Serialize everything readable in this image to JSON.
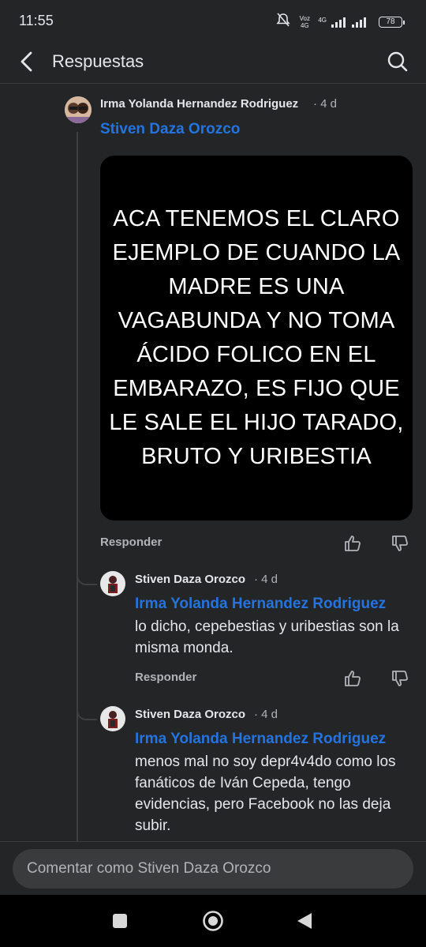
{
  "status_bar": {
    "time": "11:55",
    "volte": "Voz 4G",
    "network": "4G",
    "battery": "78",
    "icons": [
      "mute-icon",
      "signal-icon",
      "battery-icon"
    ]
  },
  "header": {
    "title": "Respuestas",
    "back_icon": "chevron-left-icon",
    "search_icon": "search-icon"
  },
  "comments": [
    {
      "author": "Irma Yolanda Hernandez Rodriguez",
      "time": "· 4 d",
      "mention": "Stiven Daza Orozco",
      "image_text": "ACA TENEMOS EL CLARO EJEMPLO DE CUANDO LA MADRE ES UNA VAGABUNDA Y NO TOMA ÁCIDO FOLICO EN EL EMBARAZO, ES FIJO QUE LE SALE EL HIJO TARADO, BRUTO Y URIBESTIA",
      "reply_label": "Responder"
    },
    {
      "author": "Stiven Daza Orozco",
      "time": "· 4 d",
      "mention": "Irma Yolanda Hernandez Rodriguez",
      "text": "lo dicho, cepebestias y uribestias son la misma monda.",
      "reply_label": "Responder"
    },
    {
      "author": "Stiven Daza Orozco",
      "time": "· 4 d",
      "mention": "Irma Yolanda Hernandez Rodriguez",
      "text": "menos mal no soy depr4v4do como los fanáticos de Iván Cepeda, tengo evidencias, pero Facebook no las deja subir."
    }
  ],
  "composer": {
    "placeholder": "Comentar como Stiven Daza Orozco"
  },
  "colors": {
    "background": "#242526",
    "mention": "#2374e1",
    "secondary_text": "#b0b3b8",
    "composer_bg": "#3a3b3c"
  },
  "nav": {
    "icons": [
      "recents-square-icon",
      "home-circle-icon",
      "back-triangle-icon"
    ]
  }
}
